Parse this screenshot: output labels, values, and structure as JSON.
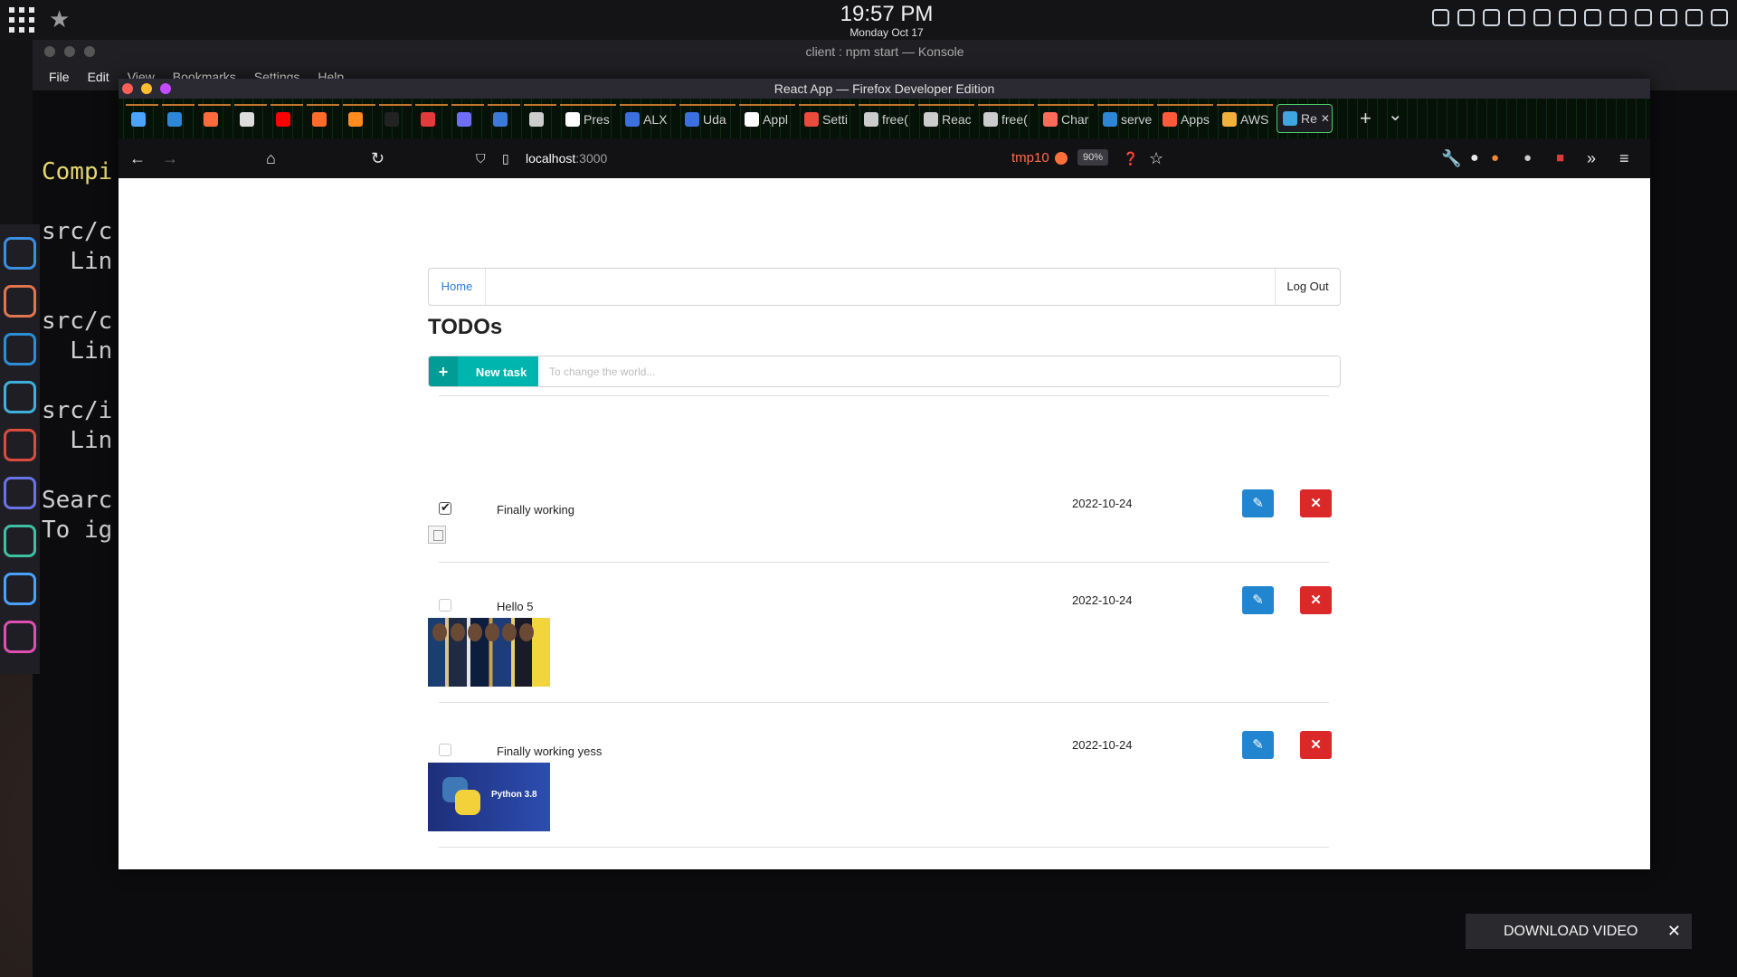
{
  "topbar": {
    "time": "19:57 PM",
    "date": "Monday Oct 17",
    "tray_icons": [
      "alert-icon",
      "chrome-icon",
      "settings-icon",
      "edit-icon",
      "cut-icon",
      "dropbox-icon",
      "display-icon",
      "clipboard-icon",
      "wifi-icon",
      "volume-icon",
      "battery-icon",
      "chevron-down-icon"
    ]
  },
  "konsole": {
    "title": "client : npm start — Konsole",
    "menu": [
      "File",
      "Edit",
      "View",
      "Bookmarks",
      "Settings",
      "Help"
    ],
    "lines": [
      {
        "text": "Compi",
        "style": "y"
      },
      {
        "text": "",
        "style": ""
      },
      {
        "text": "src/c",
        "style": ""
      },
      {
        "text": "  Lin",
        "style": ""
      },
      {
        "text": "",
        "style": ""
      },
      {
        "text": "src/c",
        "style": ""
      },
      {
        "text": "  Lin",
        "style": ""
      },
      {
        "text": "",
        "style": ""
      },
      {
        "text": "src/i",
        "style": ""
      },
      {
        "text": "  Lin",
        "style": ""
      },
      {
        "text": "",
        "style": ""
      },
      {
        "text": "Searc",
        "style": ""
      },
      {
        "text": "To ig",
        "style": ""
      }
    ]
  },
  "dock": {
    "apps": [
      {
        "name": "mail-icon",
        "color": "#3b8fe0"
      },
      {
        "name": "files-icon",
        "color": "#e2744f"
      },
      {
        "name": "vscode-icon",
        "color": "#2b8fd6"
      },
      {
        "name": "terminal-icon",
        "color": "#3fb0d9"
      },
      {
        "name": "todoist-icon",
        "color": "#db4c3f"
      },
      {
        "name": "media-player-icon",
        "color": "#6a72e8"
      },
      {
        "name": "keepass-icon",
        "color": "#3fc0a5"
      },
      {
        "name": "firefox-icon",
        "color": "#4aa0ff"
      },
      {
        "name": "notes-icon",
        "color": "#e04fb0"
      }
    ]
  },
  "firefox": {
    "window_title": "React App — Firefox Developer Edition",
    "tabs": [
      {
        "label": "",
        "color": "#4aa3ff"
      },
      {
        "label": "",
        "color": "#2e87d6"
      },
      {
        "label": "",
        "color": "#ff6a3d"
      },
      {
        "label": "",
        "color": "#dddddd"
      },
      {
        "label": "",
        "color": "#ff0000"
      },
      {
        "label": "",
        "color": "#ff6b2b"
      },
      {
        "label": "",
        "color": "#ff8a1e"
      },
      {
        "label": "",
        "color": "#222222"
      },
      {
        "label": "",
        "color": "#e33b3b"
      },
      {
        "label": "",
        "color": "#6f6ff5"
      },
      {
        "label": "",
        "color": "#3a7ad9"
      },
      {
        "label": "",
        "color": "#cccccc"
      },
      {
        "label": "Pres",
        "color": "#ffffff"
      },
      {
        "label": "ALX",
        "color": "#3c6fe0"
      },
      {
        "label": "Uda",
        "color": "#3c6fe0"
      },
      {
        "label": "Appl",
        "color": "#ffffff"
      },
      {
        "label": "Setti",
        "color": "#e94b3c"
      },
      {
        "label": "free(",
        "color": "#cccccc"
      },
      {
        "label": "Reac",
        "color": "#cccccc"
      },
      {
        "label": "free(",
        "color": "#cccccc"
      },
      {
        "label": "Char",
        "color": "#ff6b5a"
      },
      {
        "label": "serve",
        "color": "#2e87d6"
      },
      {
        "label": "Apps",
        "color": "#ff5a3a"
      },
      {
        "label": "AWS",
        "color": "#f2b13a"
      },
      {
        "label": "Re",
        "color": "#3fa7e0",
        "active": true
      }
    ],
    "url_host": "localhost",
    "url_port": ":3000",
    "container_label": "tmp10",
    "zoom": "90%"
  },
  "app": {
    "nav_home": "Home",
    "nav_logout": "Log Out",
    "title": "TODOs",
    "new_task_label": "New task",
    "new_task_placeholder": "To change the world...",
    "todos": [
      {
        "text": "Finally working",
        "date": "2022-10-24",
        "checked": true,
        "image": "broken"
      },
      {
        "text": "Hello 5",
        "date": "2022-10-24",
        "checked": false,
        "image": "players"
      },
      {
        "text": "Finally working yess",
        "date": "2022-10-24",
        "checked": false,
        "image": "python",
        "image_text": "Python 3.8"
      }
    ]
  },
  "overlay": {
    "download_video": "DOWNLOAD VIDEO"
  }
}
